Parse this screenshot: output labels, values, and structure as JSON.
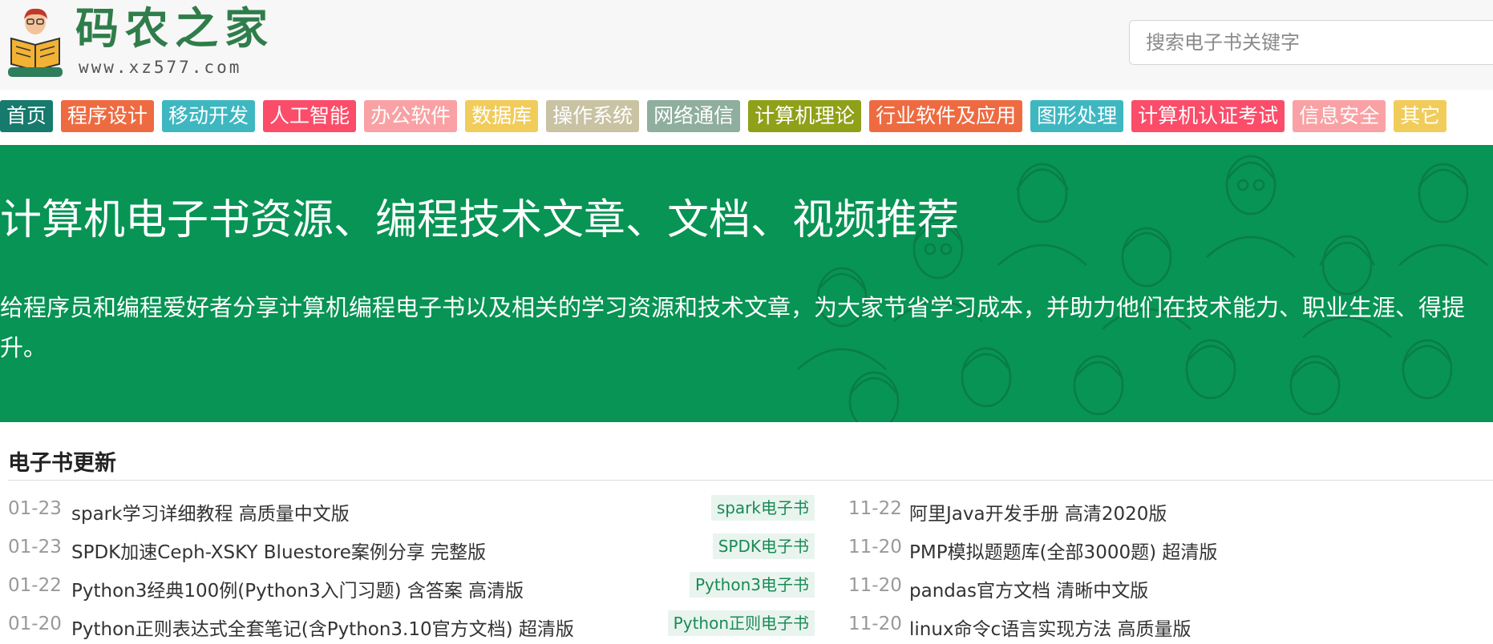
{
  "header": {
    "logo_title": "码农之家",
    "logo_url": "www.xz577.com",
    "search_placeholder": "搜索电子书关键字"
  },
  "nav": [
    {
      "label": "首页",
      "color": "#167a6d"
    },
    {
      "label": "程序设计",
      "color": "#ee6b42"
    },
    {
      "label": "移动开发",
      "color": "#3fb7c1"
    },
    {
      "label": "人工智能",
      "color": "#fb4c69"
    },
    {
      "label": "办公软件",
      "color": "#f9a1a4"
    },
    {
      "label": "数据库",
      "color": "#f1cc5a"
    },
    {
      "label": "操作系统",
      "color": "#c9c2a3"
    },
    {
      "label": "网络通信",
      "color": "#8fae9e"
    },
    {
      "label": "计算机理论",
      "color": "#8fa019"
    },
    {
      "label": "行业软件及应用",
      "color": "#ee6b42"
    },
    {
      "label": "图形处理",
      "color": "#3fb7c1"
    },
    {
      "label": "计算机认证考试",
      "color": "#fb4c69"
    },
    {
      "label": "信息安全",
      "color": "#f9a1a4"
    },
    {
      "label": "其它",
      "color": "#f1cc5a"
    }
  ],
  "banner": {
    "title": "计算机电子书资源、编程技术文章、文档、视频推荐",
    "description": "给程序员和编程爱好者分享计算机编程电子书以及相关的学习资源和技术文章，为大家节省学习成本，并助力他们在技术能力、职业生涯、得提升。",
    "background_color": "#079454"
  },
  "updates": {
    "title": "电子书更新",
    "left": [
      {
        "date": "01-23",
        "title": "spark学习详细教程 高质量中文版",
        "tag": "spark电子书"
      },
      {
        "date": "01-23",
        "title": "SPDK加速Ceph-XSKY Bluestore案例分享 完整版",
        "tag": "SPDK电子书"
      },
      {
        "date": "01-22",
        "title": "Python3经典100例(Python3入门习题) 含答案 高清版",
        "tag": "Python3电子书"
      },
      {
        "date": "01-20",
        "title": "Python正则表达式全套笔记(含Python3.10官方文档) 超清版",
        "tag": "Python正则电子书"
      }
    ],
    "right": [
      {
        "date": "11-22",
        "title": "阿里Java开发手册 高清2020版"
      },
      {
        "date": "11-20",
        "title": "PMP模拟题题库(全部3000题) 超清版"
      },
      {
        "date": "11-20",
        "title": "pandas官方文档 清晰中文版"
      },
      {
        "date": "11-20",
        "title": "linux命令c语言实现方法 高质量版"
      }
    ]
  }
}
